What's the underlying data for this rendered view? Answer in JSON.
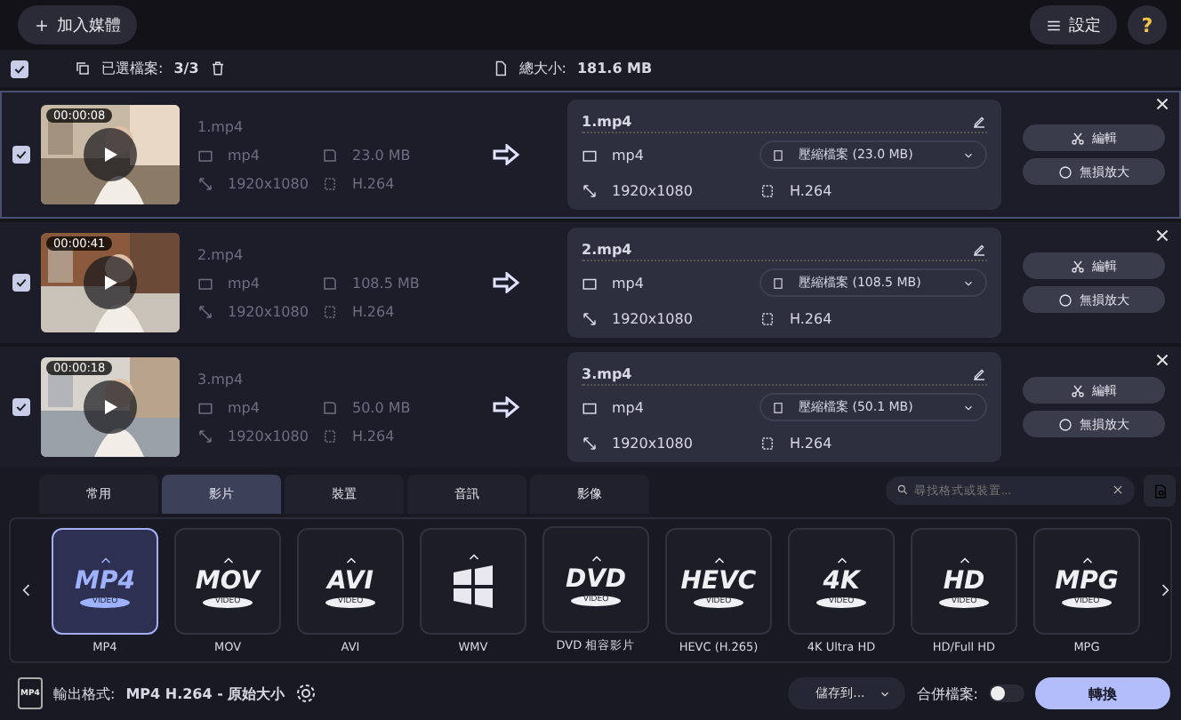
{
  "toolbar": {
    "add_media": "加入媒體",
    "settings": "設定",
    "help": "?"
  },
  "selection_bar": {
    "checked": true,
    "selected_label": "已選檔案:",
    "selected_count": "3/3",
    "total_label": "總大小:",
    "total_size": "181.6 MB"
  },
  "files": [
    {
      "checked": true,
      "duration": "00:00:08",
      "name": "1.mp4",
      "format": "mp4",
      "size": "23.0 MB",
      "resolution": "1920x1080",
      "codec": "H.264",
      "output": {
        "name": "1.mp4",
        "format": "mp4",
        "compress": "壓縮檔案 (23.0 MB)",
        "resolution": "1920x1080",
        "codec": "H.264"
      },
      "edit": "編輯",
      "upscale": "無損放大"
    },
    {
      "checked": true,
      "duration": "00:00:41",
      "name": "2.mp4",
      "format": "mp4",
      "size": "108.5 MB",
      "resolution": "1920x1080",
      "codec": "H.264",
      "output": {
        "name": "2.mp4",
        "format": "mp4",
        "compress": "壓縮檔案 (108.5 MB)",
        "resolution": "1920x1080",
        "codec": "H.264"
      },
      "edit": "編輯",
      "upscale": "無損放大"
    },
    {
      "checked": true,
      "duration": "00:00:18",
      "name": "3.mp4",
      "format": "mp4",
      "size": "50.0 MB",
      "resolution": "1920x1080",
      "codec": "H.264",
      "output": {
        "name": "3.mp4",
        "format": "mp4",
        "compress": "壓縮檔案 (50.1 MB)",
        "resolution": "1920x1080",
        "codec": "H.264"
      },
      "edit": "編輯",
      "upscale": "無損放大"
    }
  ],
  "tabs": [
    {
      "label": "常用",
      "selected": false
    },
    {
      "label": "影片",
      "selected": true
    },
    {
      "label": "裝置",
      "selected": false
    },
    {
      "label": "音訊",
      "selected": false
    },
    {
      "label": "影像",
      "selected": false
    }
  ],
  "search": {
    "placeholder": "尋找格式或裝置..."
  },
  "formats": [
    {
      "kind": "logo",
      "logo": "MP4",
      "sub": "VIDEO",
      "label": "MP4",
      "selected": true
    },
    {
      "kind": "logo",
      "logo": "MOV",
      "sub": "VIDEO",
      "label": "MOV",
      "selected": false
    },
    {
      "kind": "logo",
      "logo": "AVI",
      "sub": "VIDEO",
      "label": "AVI",
      "selected": false
    },
    {
      "kind": "windows",
      "label": "WMV",
      "selected": false
    },
    {
      "kind": "logo",
      "logo": "DVD",
      "sub": "VIDEO",
      "label": "DVD 相容影片",
      "selected": false
    },
    {
      "kind": "logo",
      "logo": "HEVC",
      "sub": "VIDEO",
      "label": "HEVC (H.265)",
      "selected": false
    },
    {
      "kind": "logo",
      "logo": "4K",
      "sub": "VIDEO",
      "label": "4K Ultra HD",
      "selected": false
    },
    {
      "kind": "logo",
      "logo": "HD",
      "sub": "VIDEO",
      "label": "HD/Full HD",
      "selected": false
    },
    {
      "kind": "logo",
      "logo": "MPG",
      "sub": "VIDEO",
      "label": "MPG",
      "selected": false
    }
  ],
  "footer": {
    "badge": "MP4",
    "output_label": "輸出格式:",
    "output_value": "MP4 H.264 - 原始大小",
    "save_to": "儲存到...",
    "merge_label": "合併檔案:",
    "merge_on": false,
    "convert": "轉換"
  }
}
